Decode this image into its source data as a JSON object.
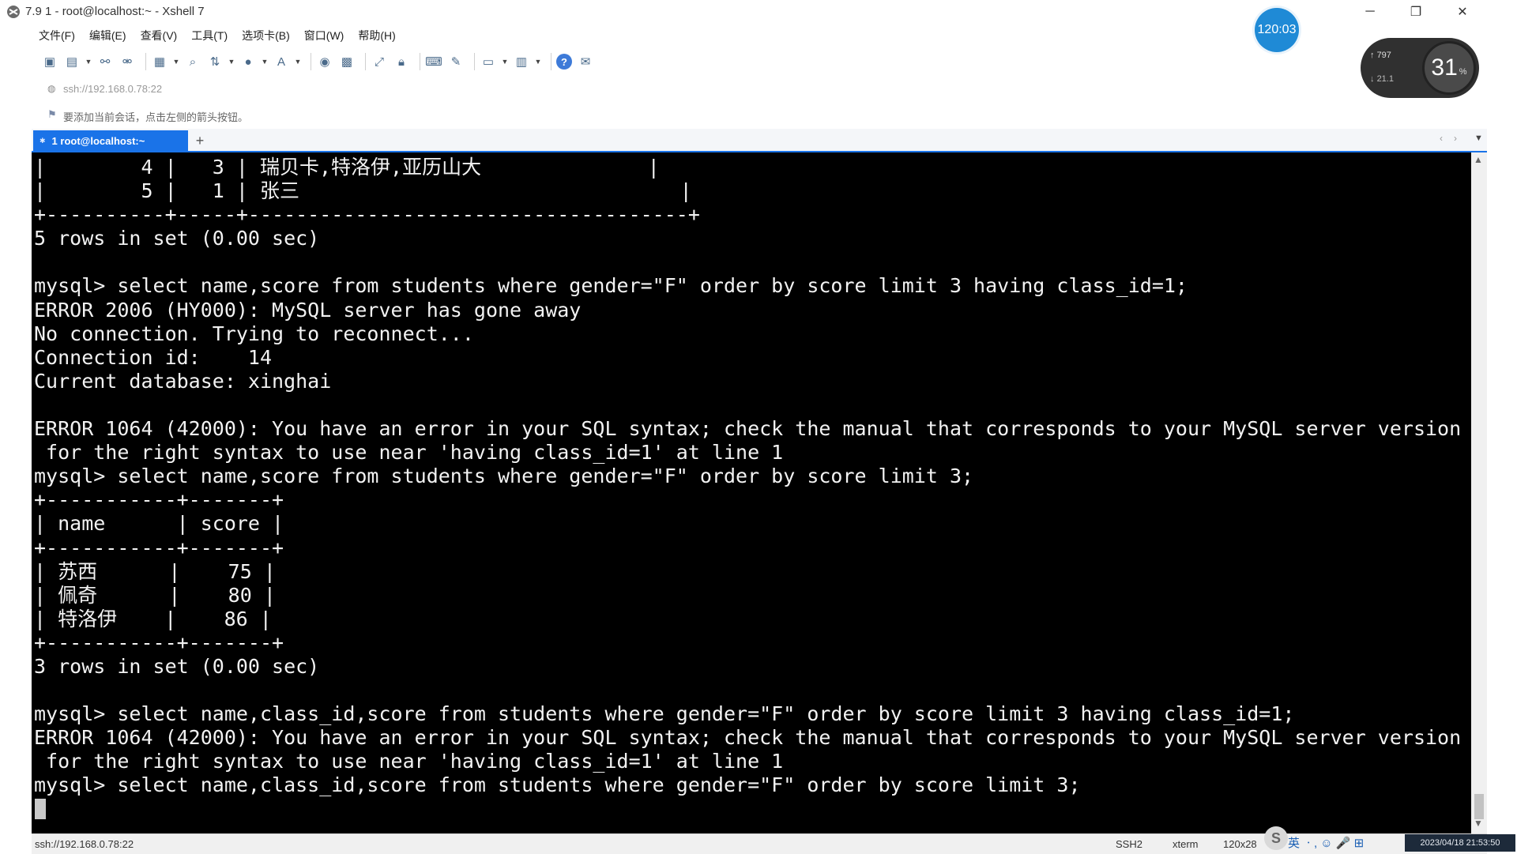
{
  "window": {
    "title": "7.9 1 - root@localhost:~ - Xshell 7",
    "minimize_glyph": "─",
    "maximize_glyph": "❐",
    "close_glyph": "✕"
  },
  "menu": {
    "items": [
      "文件(F)",
      "编辑(E)",
      "查看(V)",
      "工具(T)",
      "选项卡(B)",
      "窗口(W)",
      "帮助(H)"
    ]
  },
  "toolbar": {
    "icons": [
      "new-session-icon",
      "open-folder-icon",
      "connect-icon",
      "disconnect-icon",
      "properties-icon",
      "find-icon",
      "transfer-icon",
      "globe-icon",
      "font-icon",
      "xftp-icon",
      "xmanager-icon",
      "fullscreen-icon",
      "lock-icon",
      "keyboard-icon",
      "script-icon",
      "layout-icon",
      "compose-icon",
      "help-icon",
      "chat-icon"
    ]
  },
  "address": {
    "text": "ssh://192.168.0.78:22"
  },
  "hint": {
    "text": "要添加当前会话，点击左侧的箭头按钮。"
  },
  "tabs": {
    "active_label": "1 root@localhost:~",
    "add_glyph": "+"
  },
  "terminal": {
    "lines": [
      "|        4 |   3 | 瑞贝卡,特洛伊,亚历山大              |",
      "|        5 |   1 | 张三                                |",
      "+----------+-----+-------------------------------------+",
      "5 rows in set (0.00 sec)",
      "",
      "mysql> select name,score from students where gender=\"F\" order by score limit 3 having class_id=1;",
      "ERROR 2006 (HY000): MySQL server has gone away",
      "No connection. Trying to reconnect...",
      "Connection id:    14",
      "Current database: xinghai",
      "",
      "ERROR 1064 (42000): You have an error in your SQL syntax; check the manual that corresponds to your MySQL server version",
      " for the right syntax to use near 'having class_id=1' at line 1",
      "mysql> select name,score from students where gender=\"F\" order by score limit 3;",
      "+-----------+-------+",
      "| name      | score |",
      "+-----------+-------+",
      "| 苏西      |    75 |",
      "| 佩奇      |    80 |",
      "| 特洛伊    |    86 |",
      "+-----------+-------+",
      "3 rows in set (0.00 sec)",
      "",
      "mysql> select name,class_id,score from students where gender=\"F\" order by score limit 3 having class_id=1;",
      "ERROR 1064 (42000): You have an error in your SQL syntax; check the manual that corresponds to your MySQL server version",
      " for the right syntax to use near 'having class_id=1' at line 1",
      "mysql> select name,class_id,score from students where gender=\"F\" order by score limit 3;"
    ]
  },
  "status": {
    "address": "ssh://192.168.0.78:22",
    "protocol": "SSH2",
    "term_type": "xterm",
    "size": "120x28"
  },
  "tray": {
    "ime_text": "英 ㆍ, ☺ 🎤 ⊞",
    "datetime": "2023/04/18 21:53:50"
  },
  "overlay": {
    "timer": "120:03",
    "net_up": "797",
    "net_down": "21.1",
    "gauge_value": "31",
    "gauge_unit": "%"
  },
  "colors": {
    "tab_accent": "#1a73e8",
    "terminal_bg": "#000000",
    "terminal_fg": "#f2f2f2",
    "timer_badge": "#1f8ad6"
  }
}
